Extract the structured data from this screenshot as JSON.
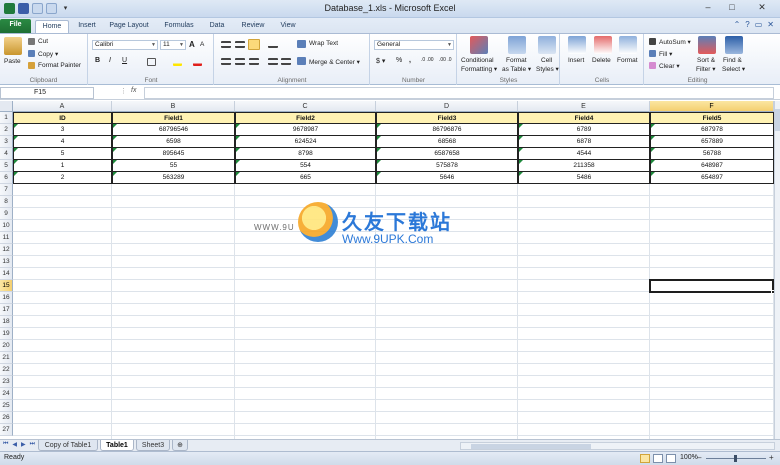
{
  "window": {
    "title": "Database_1.xls - Microsoft Excel",
    "minimize": "–",
    "maximize": "□",
    "close": "✕"
  },
  "qat": {
    "dropdown": "▾"
  },
  "ribbon_tabs": [
    {
      "label": "File"
    },
    {
      "label": "Home"
    },
    {
      "label": "Insert"
    },
    {
      "label": "Page Layout"
    },
    {
      "label": "Formulas"
    },
    {
      "label": "Data"
    },
    {
      "label": "Review"
    },
    {
      "label": "View"
    }
  ],
  "ribbon": {
    "clipboard": {
      "paste": "Paste",
      "cut": "Cut",
      "copy": "Copy ▾",
      "format_painter": "Format Painter",
      "group": "Clipboard"
    },
    "font": {
      "name": "Calibri",
      "size": "11",
      "bold": "B",
      "italic": "I",
      "underline": "U",
      "group": "Font",
      "grow": "A",
      "shrink": "A"
    },
    "alignment": {
      "wrap": "Wrap Text",
      "merge": "Merge & Center ▾",
      "group": "Alignment"
    },
    "number": {
      "format": "General",
      "currency": "$ ▾",
      "percent": "%",
      "comma": ",",
      "inc_dec": ".0 .00",
      "dec_dec": ".00 .0",
      "group": "Number"
    },
    "styles": {
      "conditional": "Conditional",
      "conditional2": "Formatting ▾",
      "format_table": "Format",
      "format_table2": "as Table ▾",
      "cell_styles": "Cell",
      "cell_styles2": "Styles ▾",
      "group": "Styles"
    },
    "cells": {
      "insert": "Insert",
      "delete": "Delete",
      "format": "Format",
      "group": "Cells"
    },
    "editing": {
      "autosum": "AutoSum ▾",
      "fill": "Fill ▾",
      "clear": "Clear ▾",
      "sort": "Sort &",
      "sort2": "Filter ▾",
      "find": "Find &",
      "find2": "Select ▾",
      "group": "Editing"
    }
  },
  "formula_bar": {
    "name_box": "F15",
    "fx": "fx",
    "value": ""
  },
  "columns": [
    "A",
    "B",
    "C",
    "D",
    "E",
    "F"
  ],
  "selected_column": "F",
  "rows": [
    "1",
    "2",
    "3",
    "4",
    "5",
    "6",
    "7",
    "8",
    "9",
    "10",
    "11",
    "12",
    "13",
    "14",
    "15",
    "16",
    "17",
    "18",
    "19",
    "20",
    "21",
    "22",
    "23",
    "24",
    "25",
    "26",
    "27"
  ],
  "selected_row": "15",
  "table": {
    "headers": [
      "ID",
      "Field1",
      "Field2",
      "Field3",
      "Field4",
      "Field5"
    ],
    "rows": [
      [
        "3",
        "68796546",
        "9678987",
        "86796876",
        "6789",
        "687978"
      ],
      [
        "4",
        "6598",
        "624524",
        "68568",
        "6878",
        "657889"
      ],
      [
        "5",
        "895645",
        "8798",
        "6587658",
        "4544",
        "56788"
      ],
      [
        "1",
        "55",
        "554",
        "575878",
        "211358",
        "648987"
      ],
      [
        "2",
        "563289",
        "665",
        "5646",
        "5486",
        "654897"
      ]
    ]
  },
  "watermark": {
    "left": "WWW.9U",
    "cn": "久友下载站",
    "url": "Www.9UPK.Com"
  },
  "sheet_tabs": [
    {
      "label": "Copy of Table1"
    },
    {
      "label": "Table1"
    },
    {
      "label": "Sheet3"
    }
  ],
  "sheet_nav": {
    "first": "⏮",
    "prev": "◀",
    "next": "▶",
    "last": "⏭"
  },
  "status": {
    "ready": "Ready",
    "zoom": "100%",
    "zoom_minus": "–",
    "zoom_plus": "+"
  }
}
